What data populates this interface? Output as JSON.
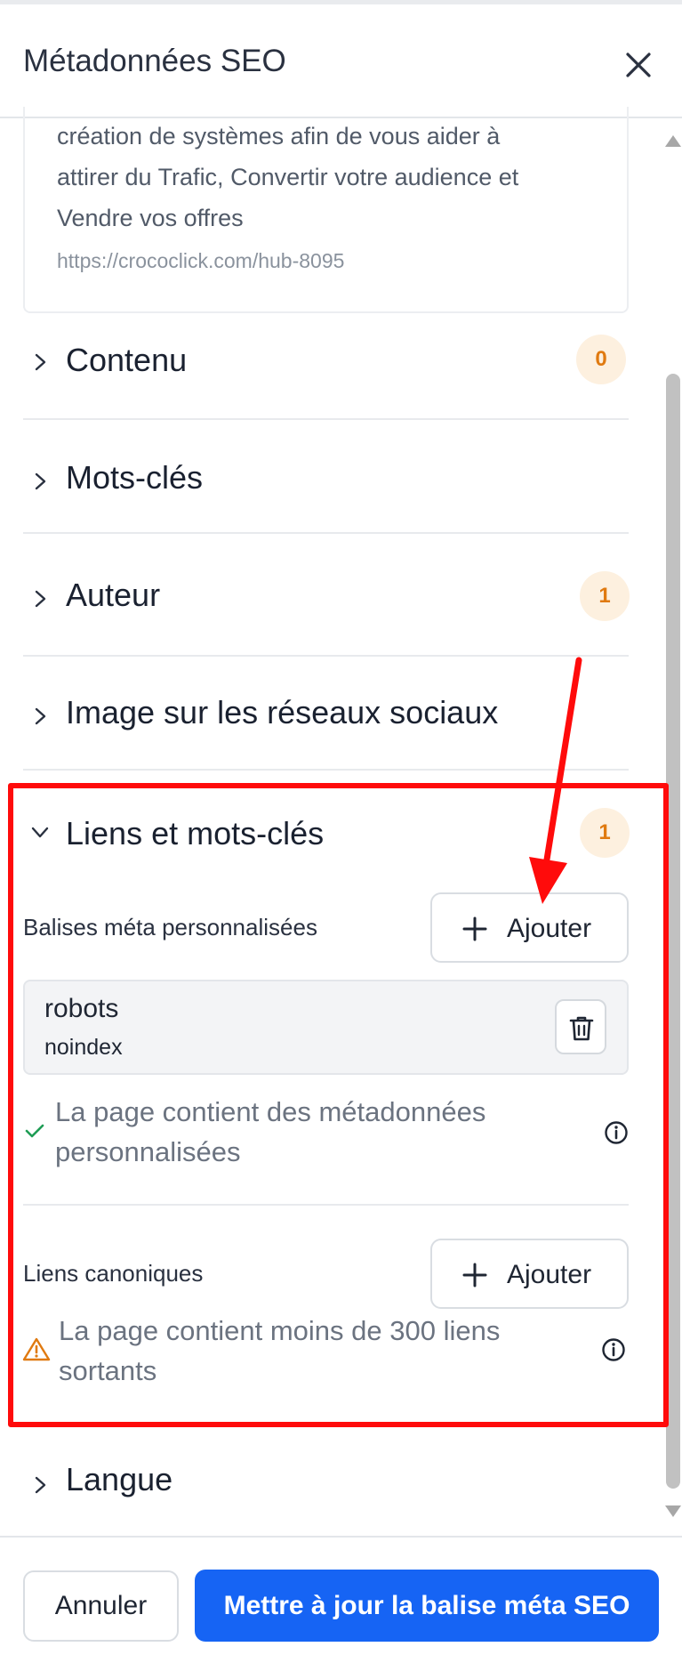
{
  "header": {
    "title": "Métadonnées SEO",
    "close_icon": "close-icon"
  },
  "preview": {
    "description_lines": [
      "création de systèmes afin de vous aider à",
      "attirer du Trafic, Convertir votre audience et",
      "Vendre vos offres"
    ],
    "url": "https://crococlick.com/hub-8095"
  },
  "sections": [
    {
      "label": "Contenu",
      "badge": "0",
      "expanded": false
    },
    {
      "label": "Mots-clés",
      "badge": null,
      "expanded": false
    },
    {
      "label": "Auteur",
      "badge": "1",
      "expanded": false
    },
    {
      "label": "Image sur les réseaux sociaux",
      "badge": null,
      "expanded": false
    },
    {
      "label": "Liens et mots-clés",
      "badge": "1",
      "expanded": true
    },
    {
      "label": "Langue",
      "badge": null,
      "expanded": false
    }
  ],
  "links_section": {
    "meta_tags_label": "Balises méta personnalisées",
    "add_label": "Ajouter",
    "meta_tag": {
      "name": "robots",
      "value": "noindex"
    },
    "meta_status": [
      "La page contient des métadonnées",
      "personnalisées"
    ],
    "canonical_label": "Liens canoniques",
    "canonical_add_label": "Ajouter",
    "canonical_status": [
      "La page contient moins de 300 liens",
      "sortants"
    ]
  },
  "footer": {
    "cancel_label": "Annuler",
    "submit_label": "Mettre à jour la balise méta SEO"
  },
  "colors": {
    "accent": "#1664f4",
    "badge_bg": "#fdf0df",
    "badge_text": "#e07a10",
    "success": "#1f9d55",
    "warning": "#e07a10",
    "highlight": "#ff0b0b",
    "annotation_arrow": "#ff0b0b"
  },
  "annotation": {
    "type": "arrow",
    "points_to": "add-meta-tag-button"
  }
}
